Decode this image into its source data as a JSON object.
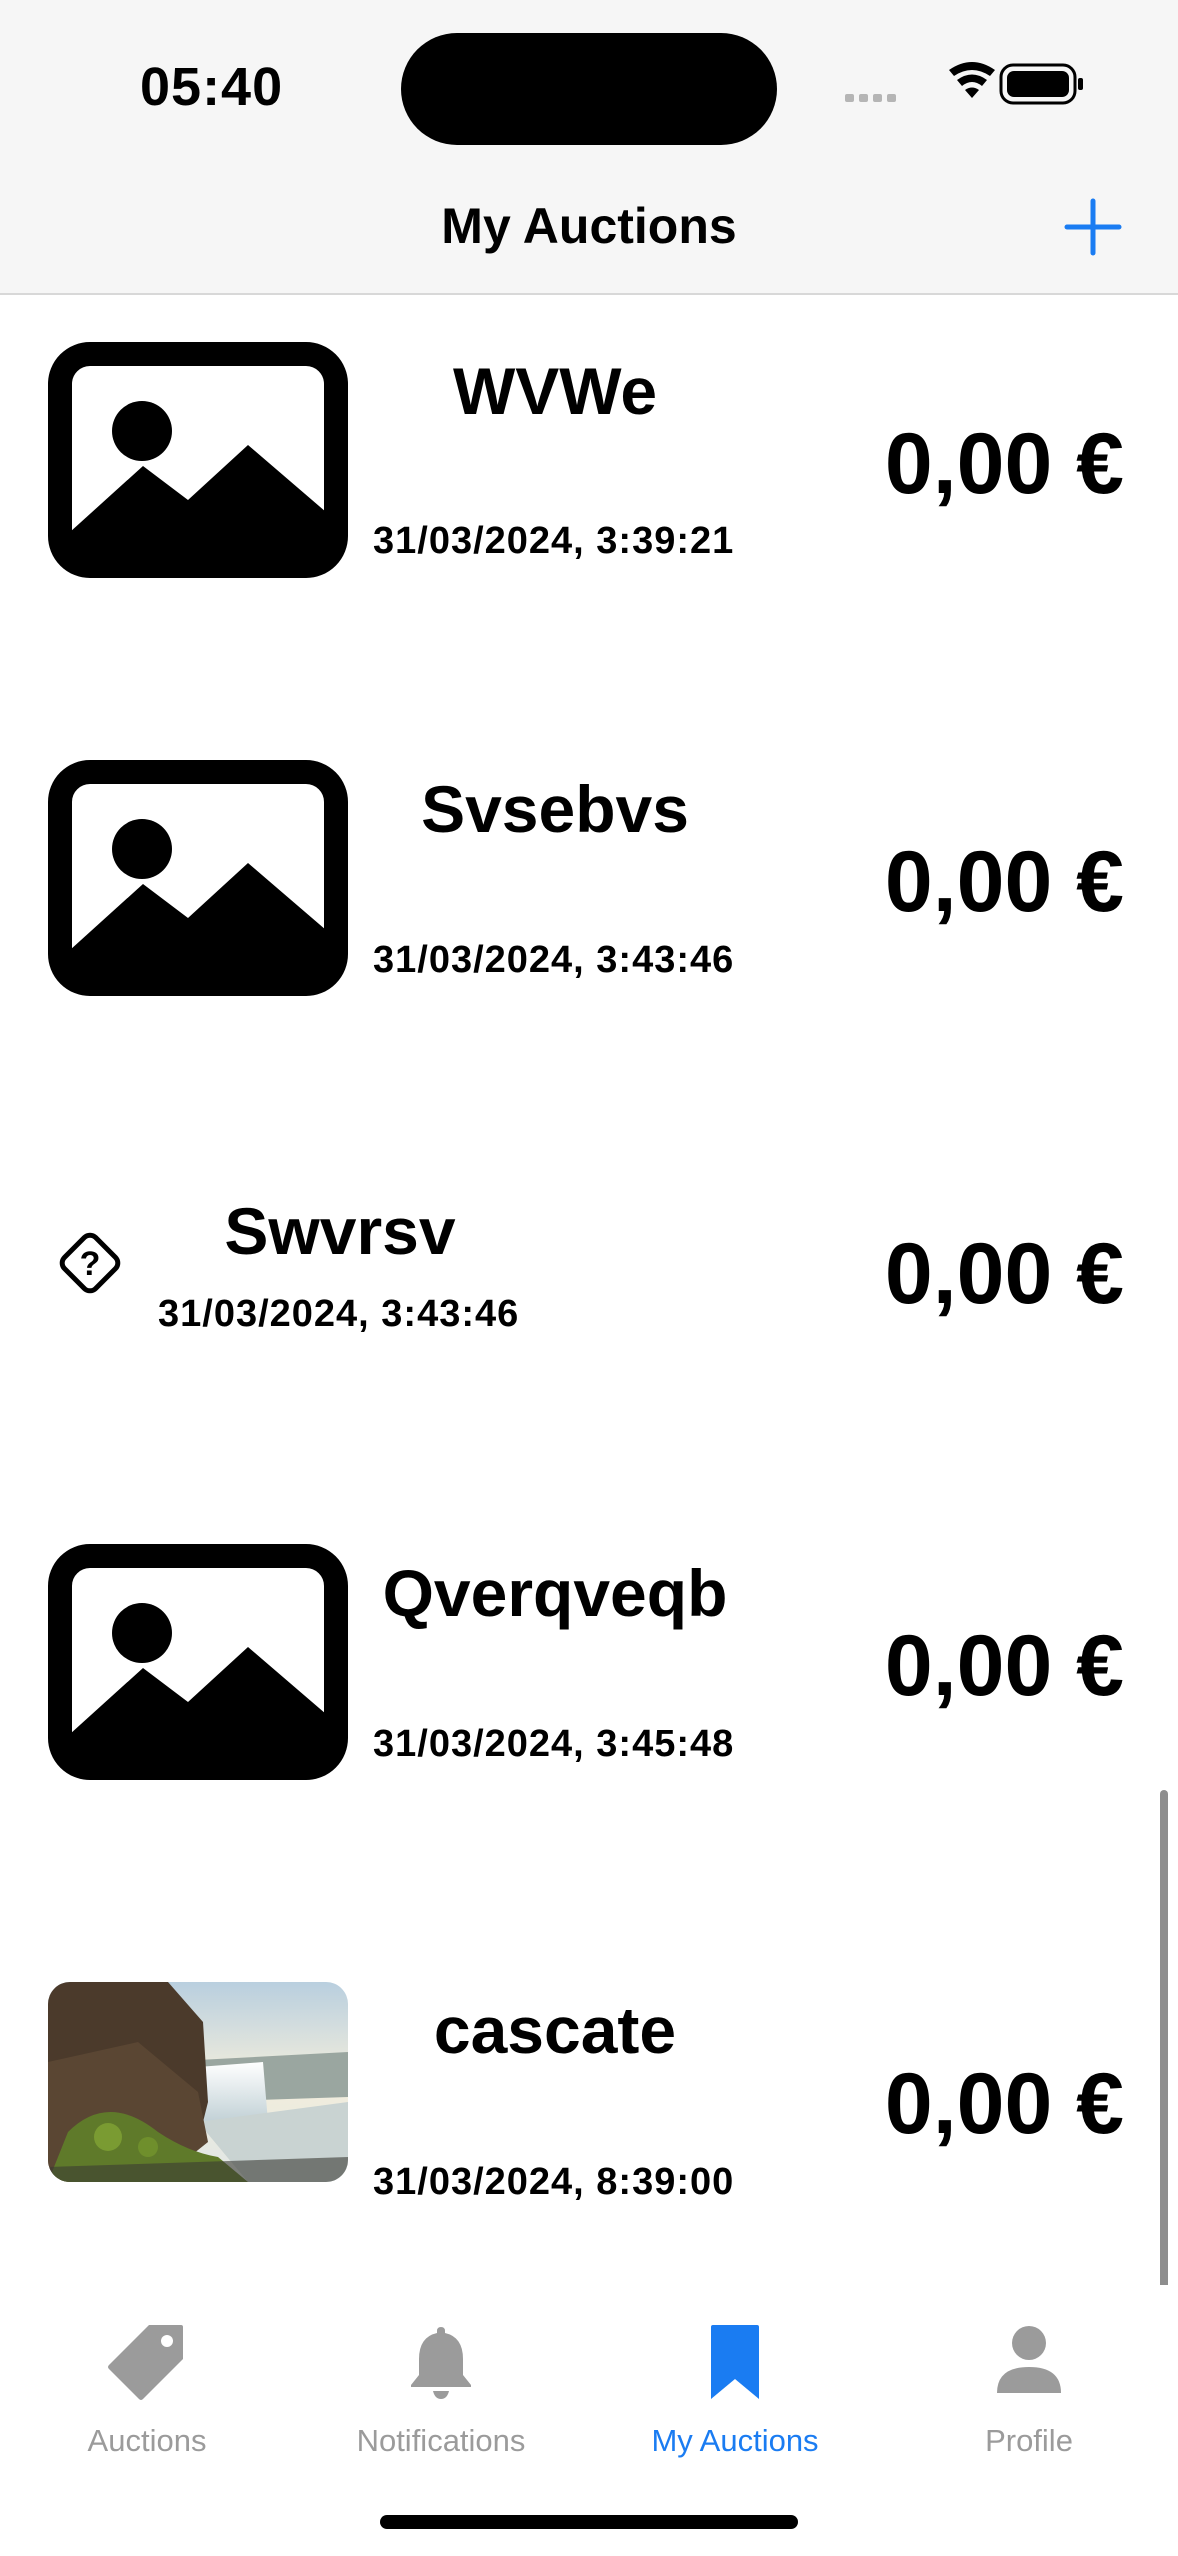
{
  "status_bar": {
    "time": "05:40"
  },
  "nav": {
    "title": "My Auctions",
    "add_icon": "plus-icon",
    "accent": "#1a7cf2"
  },
  "auctions": [
    {
      "title": "WVWe",
      "date": "31/03/2024, 3:39:21",
      "price": "0,00 €",
      "image": "photo-placeholder-icon"
    },
    {
      "title": "Svsebvs",
      "date": "31/03/2024, 3:43:46",
      "price": "0,00 €",
      "image": "photo-placeholder-icon"
    },
    {
      "title": "Swvrsv",
      "date": "31/03/2024, 3:43:46",
      "price": "0,00 €",
      "image": "unknown-image-icon"
    },
    {
      "title": "Qverqveqb",
      "date": "31/03/2024, 3:45:48",
      "price": "0,00 €",
      "image": "photo-placeholder-icon"
    },
    {
      "title": "cascate",
      "date": "31/03/2024, 8:39:00",
      "price": "0,00 €",
      "image": "waterfall-photo"
    }
  ],
  "tabs": [
    {
      "label": "Auctions",
      "icon": "tag-icon",
      "active": false
    },
    {
      "label": "Notifications",
      "icon": "bell-icon",
      "active": false
    },
    {
      "label": "My Auctions",
      "icon": "bookmark-icon",
      "active": true
    },
    {
      "label": "Profile",
      "icon": "person-icon",
      "active": false
    }
  ],
  "colors": {
    "active_tab": "#1a7cf2",
    "inactive_tab": "#9b9b9b"
  }
}
